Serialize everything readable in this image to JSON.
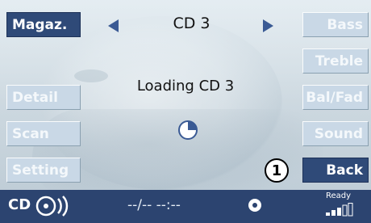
{
  "left_menu": {
    "magaz": "Magaz.",
    "detail": "Detail",
    "scan": "Scan",
    "setting": "Setting"
  },
  "right_menu": {
    "bass": "Bass",
    "treble": "Treble",
    "balfad": "Bal/Fad",
    "sound": "Sound",
    "back": "Back"
  },
  "header": {
    "title": "CD 3",
    "prev_icon": "left-triangle-arrow",
    "next_icon": "right-triangle-arrow"
  },
  "main": {
    "loading_text": "Loading CD 3",
    "busy_icon": "progress-pie-icon"
  },
  "callout": {
    "number": "1"
  },
  "status_bar": {
    "source": "CD",
    "source_icon": "cd-disc-icon",
    "track_time": "--/-- --:--",
    "dot_icon": "record-dot-icon",
    "ready": "Ready",
    "signal_icon": "signal-strength-icon"
  },
  "colors": {
    "active_button": "#2f4a78",
    "inactive_button": "#c9d8e6",
    "status_bar": "#2c4470",
    "arrow": "#3a5a94"
  }
}
